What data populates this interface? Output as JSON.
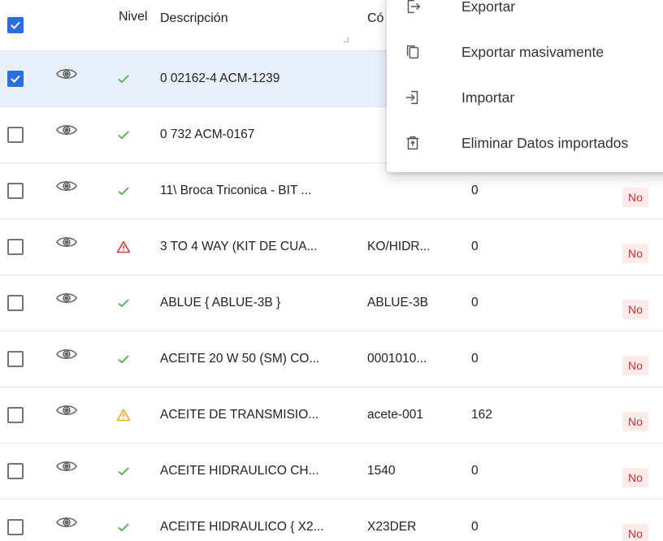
{
  "header": {
    "nivel": "Nivel",
    "descripcion": "Descripción",
    "codigo": "Có"
  },
  "rows": [
    {
      "selected": true,
      "level": "ok",
      "descripcion": "0 02162-4 ACM-1239",
      "codigo": "",
      "cantidad": "",
      "badge": ""
    },
    {
      "selected": false,
      "level": "ok",
      "descripcion": "0 732 ACM-0167",
      "codigo": "",
      "cantidad": "",
      "badge": ""
    },
    {
      "selected": false,
      "level": "ok",
      "descripcion": "11\\ Broca Triconica - BIT ...",
      "codigo": "",
      "cantidad": "0",
      "badge": "No"
    },
    {
      "selected": false,
      "level": "error",
      "descripcion": "3 TO 4 WAY (KIT DE CUA...",
      "codigo": "KO/HIDR...",
      "cantidad": "0",
      "badge": "No"
    },
    {
      "selected": false,
      "level": "ok",
      "descripcion": "ABLUE { ABLUE-3B }",
      "codigo": "ABLUE-3B",
      "cantidad": "0",
      "badge": "No"
    },
    {
      "selected": false,
      "level": "ok",
      "descripcion": "ACEITE 20 W 50 (SM) CO...",
      "codigo": "0001010...",
      "cantidad": "0",
      "badge": "No"
    },
    {
      "selected": false,
      "level": "warn",
      "descripcion": "ACEITE DE TRANSMISIO...",
      "codigo": "acete-001",
      "cantidad": "162",
      "badge": "No"
    },
    {
      "selected": false,
      "level": "ok",
      "descripcion": "ACEITE HIDRAULICO CH...",
      "codigo": "1540",
      "cantidad": "0",
      "badge": "No"
    },
    {
      "selected": false,
      "level": "ok",
      "descripcion": "ACEITE HIDRAULICO { X2...",
      "codigo": "X23DER",
      "cantidad": "0",
      "badge": "No"
    }
  ],
  "menu": {
    "items": [
      {
        "label": "Exportar",
        "icon": "export-icon"
      },
      {
        "label": "Exportar masivamente",
        "icon": "copy-icon"
      },
      {
        "label": "Importar",
        "icon": "import-icon"
      },
      {
        "label": "Eliminar Datos importados",
        "icon": "trash-icon"
      }
    ]
  },
  "colors": {
    "accent": "#2a6fdb",
    "ok": "#4caf50",
    "error": "#e53935",
    "warn": "#f5a623",
    "badge_bg": "#fdeaea",
    "badge_text": "#d32f2f",
    "selected_row": "#e8f0fc"
  }
}
